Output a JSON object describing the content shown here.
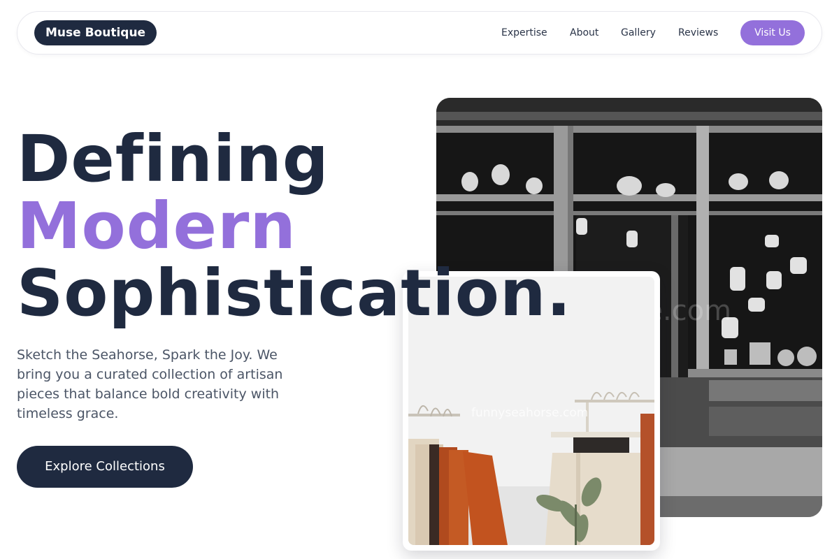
{
  "brand": {
    "name": "Muse Boutique"
  },
  "nav": {
    "links": [
      "Expertise",
      "About",
      "Gallery",
      "Reviews"
    ],
    "cta": "Visit Us"
  },
  "hero": {
    "headline": {
      "line1": "Defining",
      "line2": "Modern",
      "line3": "Sophistication."
    },
    "subtitle": "Sketch the Seahorse, Spark the Joy. We bring you a curated collection of artisan pieces that balance bold creativity with timeless grace.",
    "cta": "Explore Collections"
  },
  "images": {
    "storefront": {
      "watermark": "rse.com"
    },
    "clothing_rack": {
      "watermark": "funnyseahorse.com"
    }
  },
  "colors": {
    "primary_dark": "#1f2a40",
    "accent": "#9370db",
    "text_muted": "#4b5566"
  }
}
